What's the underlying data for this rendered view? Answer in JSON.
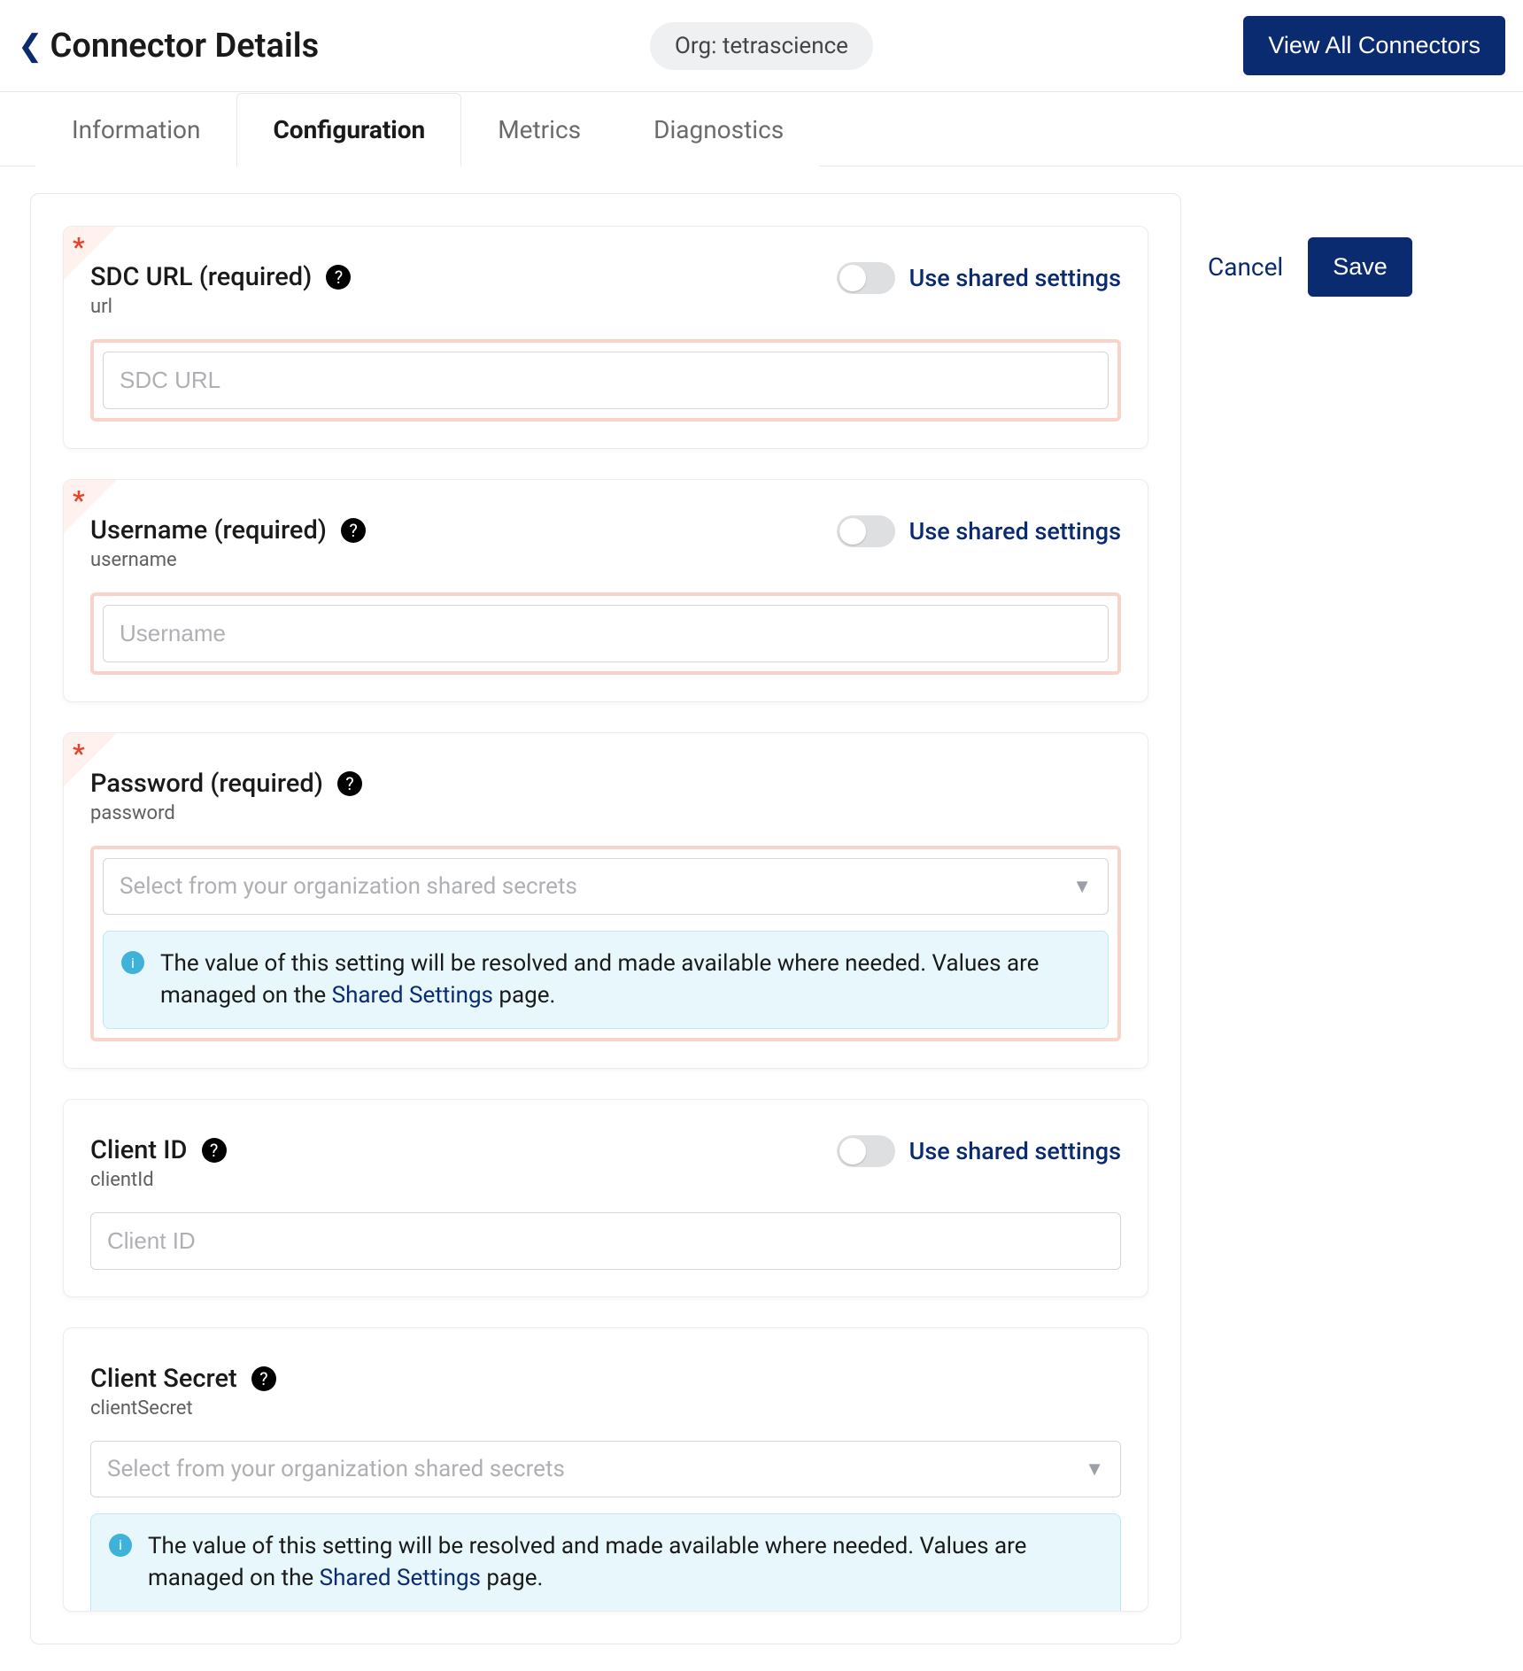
{
  "header": {
    "title": "Connector Details",
    "org_badge": "Org: tetrascience",
    "view_all": "View All Connectors"
  },
  "tabs": {
    "information": "Information",
    "configuration": "Configuration",
    "metrics": "Metrics",
    "diagnostics": "Diagnostics"
  },
  "actions": {
    "cancel": "Cancel",
    "save": "Save"
  },
  "shared_toggle_label": "Use shared settings",
  "info_banner": {
    "pre": "The value of this setting will be resolved and made available where needed. Values are managed on the ",
    "link": "Shared Settings",
    "post": " page."
  },
  "fields": {
    "sdc_url": {
      "label": "SDC URL (required)",
      "slug": "url",
      "placeholder": "SDC URL"
    },
    "username": {
      "label": "Username (required)",
      "slug": "username",
      "placeholder": "Username"
    },
    "password": {
      "label": "Password (required)",
      "slug": "password",
      "select_placeholder": "Select from your organization shared secrets"
    },
    "client_id": {
      "label": "Client ID",
      "slug": "clientId",
      "placeholder": "Client ID"
    },
    "client_secret": {
      "label": "Client Secret",
      "slug": "clientSecret",
      "select_placeholder": "Select from your organization shared secrets"
    }
  }
}
